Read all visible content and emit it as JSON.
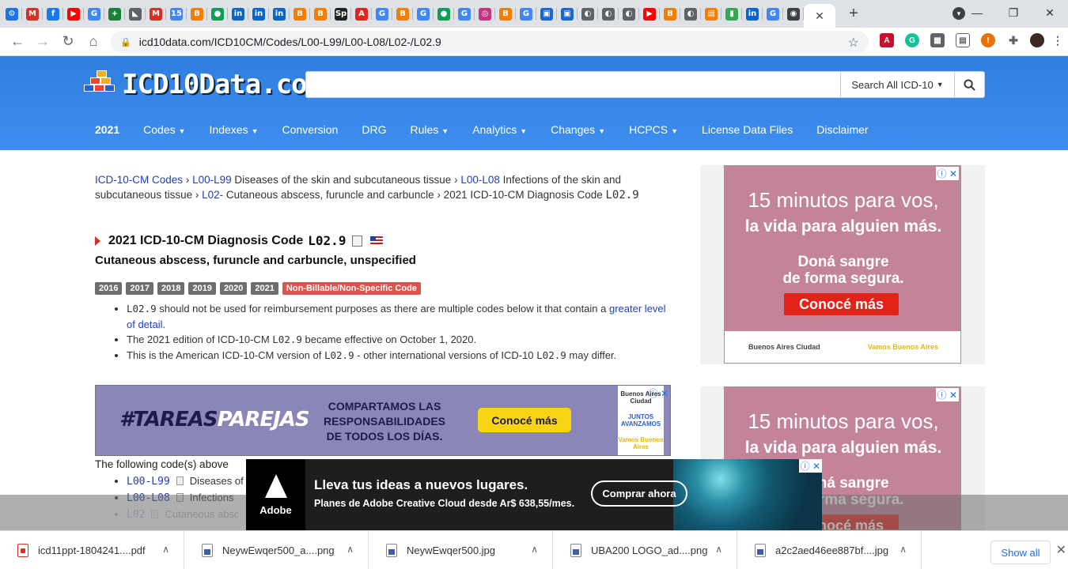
{
  "browser": {
    "tabs": [
      {
        "icon": "gear-icon",
        "glyph": "⚙",
        "color": "#1a73e8"
      },
      {
        "icon": "gmail-icon",
        "glyph": "M",
        "color": "#d93025"
      },
      {
        "icon": "facebook-icon",
        "glyph": "f",
        "color": "#1877f2"
      },
      {
        "icon": "youtube-icon",
        "glyph": "▶",
        "color": "#ff0000"
      },
      {
        "icon": "google-icon",
        "glyph": "G",
        "color": "#4285f4"
      },
      {
        "icon": "sheets-plus-icon",
        "glyph": "+",
        "color": "#188038"
      },
      {
        "icon": "bird-icon",
        "glyph": "◣",
        "color": "#5f6368"
      },
      {
        "icon": "gmail-icon",
        "glyph": "M",
        "color": "#d93025"
      },
      {
        "icon": "calendar-icon",
        "glyph": "15",
        "color": "#4285f4"
      },
      {
        "icon": "blogger-icon",
        "glyph": "B",
        "color": "#f57d00"
      },
      {
        "icon": "green-circle-icon",
        "glyph": "●",
        "color": "#0f9d58"
      },
      {
        "icon": "linkedin-icon",
        "glyph": "in",
        "color": "#0a66c2"
      },
      {
        "icon": "linkedin-icon",
        "glyph": "in",
        "color": "#0a66c2"
      },
      {
        "icon": "linkedin-icon",
        "glyph": "in",
        "color": "#0a66c2"
      },
      {
        "icon": "blogger-icon",
        "glyph": "B",
        "color": "#f57d00"
      },
      {
        "icon": "blogger-icon",
        "glyph": "B",
        "color": "#f57d00"
      },
      {
        "icon": "sp-icon",
        "glyph": "Sp",
        "color": "#222222"
      },
      {
        "icon": "adobe-icon",
        "glyph": "A",
        "color": "#e1251b"
      },
      {
        "icon": "google-icon",
        "glyph": "G",
        "color": "#4285f4"
      },
      {
        "icon": "blogger-icon",
        "glyph": "B",
        "color": "#f57d00"
      },
      {
        "icon": "translate-icon",
        "glyph": "G",
        "color": "#4285f4"
      },
      {
        "icon": "green-circle-icon",
        "glyph": "●",
        "color": "#0f9d58"
      },
      {
        "icon": "google-icon",
        "glyph": "G",
        "color": "#4285f4"
      },
      {
        "icon": "instagram-icon",
        "glyph": "◎",
        "color": "#c13584"
      },
      {
        "icon": "blogger-icon",
        "glyph": "B",
        "color": "#f57d00"
      },
      {
        "icon": "translate-icon",
        "glyph": "G",
        "color": "#4285f4"
      },
      {
        "icon": "blue-square-icon",
        "glyph": "▣",
        "color": "#1967d2"
      },
      {
        "icon": "blue-square-icon",
        "glyph": "▣",
        "color": "#1967d2"
      },
      {
        "icon": "globe-icon",
        "glyph": "◐",
        "color": "#5f6368"
      },
      {
        "icon": "globe-icon",
        "glyph": "◐",
        "color": "#5f6368"
      },
      {
        "icon": "globe-icon",
        "glyph": "◐",
        "color": "#5f6368"
      },
      {
        "icon": "youtube-icon",
        "glyph": "▶",
        "color": "#ff0000"
      },
      {
        "icon": "blogger-icon",
        "glyph": "B",
        "color": "#f57d00"
      },
      {
        "icon": "globe-icon",
        "glyph": "◐",
        "color": "#5f6368"
      },
      {
        "icon": "orange-square-icon",
        "glyph": "▤",
        "color": "#f57d00"
      },
      {
        "icon": "bookmark-icon",
        "glyph": "▮",
        "color": "#34a853"
      },
      {
        "icon": "linkedin-icon",
        "glyph": "in",
        "color": "#0a66c2"
      },
      {
        "icon": "google-icon",
        "glyph": "G",
        "color": "#4285f4"
      },
      {
        "icon": "chrome-icon",
        "glyph": "◉",
        "color": "#3c4043"
      }
    ],
    "active_tab_close": "✕",
    "new_tab": "+",
    "window_controls": {
      "minimize": "—",
      "restore": "❐",
      "close": "✕"
    },
    "url": "icd10data.com/ICD10CM/Codes/L00-L99/L00-L08/L02-/L02.9"
  },
  "site": {
    "logo_text": "ICD10Data.com",
    "search_placeholder": "",
    "search_scope": "Search All ICD-10",
    "nav": [
      {
        "label": "2021",
        "dropdown": false
      },
      {
        "label": "Codes",
        "dropdown": true
      },
      {
        "label": "Indexes",
        "dropdown": true
      },
      {
        "label": "Conversion",
        "dropdown": false
      },
      {
        "label": "DRG",
        "dropdown": false
      },
      {
        "label": "Rules",
        "dropdown": true
      },
      {
        "label": "Analytics",
        "dropdown": true
      },
      {
        "label": "Changes",
        "dropdown": true
      },
      {
        "label": "HCPCS",
        "dropdown": true
      },
      {
        "label": "License Data Files",
        "dropdown": false
      },
      {
        "label": "Disclaimer",
        "dropdown": false
      }
    ]
  },
  "content": {
    "breadcrumb": {
      "c1_link": "ICD-10-CM Codes",
      "c2_link": "L00-L99",
      "c2_text": "Diseases of the skin and subcutaneous tissue",
      "c3_link": "L00-L08",
      "c3_text": "Infections of the skin and subcutaneous tissue",
      "c4_link": "L02-",
      "c4_text": "Cutaneous abscess, furuncle and carbuncle",
      "c5_text": "2021 ICD-10-CM Diagnosis Code",
      "c5_code": "L02.9",
      "sep": "›"
    },
    "title_prefix": "2021 ICD-10-CM Diagnosis Code",
    "title_code": "L02.9",
    "subtitle": "Cutaneous abscess, furuncle and carbuncle, unspecified",
    "years": [
      "2016",
      "2017",
      "2018",
      "2019",
      "2020",
      "2021"
    ],
    "billable_badge": "Non-Billable/Non-Specific Code",
    "bullets": {
      "b1_code": "L02.9",
      "b1_text": "should not be used for reimbursement purposes as there are multiple codes below it that contain a",
      "b1_link": "greater level of detail",
      "b1_end": ".",
      "b2_a": "The 2021 edition of ICD-10-CM",
      "b2_code": "L02.9",
      "b2_b": "became effective on October 1, 2020.",
      "b3_a": "This is the American ICD-10-CM version of",
      "b3_code": "L02.9",
      "b3_b": "- other international versions of ICD-10",
      "b3_code2": "L02.9",
      "b3_c": "may differ."
    },
    "following_text": "The following code(s) above",
    "sub_items": [
      {
        "code": "L00-L99",
        "text": "Diseases of"
      },
      {
        "code": "L00-L08",
        "text": "Infections"
      },
      {
        "code": "L02",
        "text": "Cutaneous absc"
      }
    ]
  },
  "ads": {
    "banner": {
      "tag_a": "#TAREAS",
      "tag_b": "PAREJAS",
      "mid_text": "COMPARTAMOS LAS RESPONSABILIDADES DE TODOS LOS DÍAS.",
      "button": "Conocé más",
      "logo_1": "Buenos Aires Ciudad",
      "logo_2": "JUNTOS AVANZAMOS",
      "logo_3": "Vamos Buenos Aires"
    },
    "side": {
      "head_1": "15 minutos para vos,",
      "head_2": "la vida para alguien más.",
      "sub_1": "Doná sangre",
      "sub_2": "de forma segura.",
      "button": "Conocé más",
      "logo_1": "Buenos Aires Ciudad",
      "logo_2": "Vamos Buenos Aires"
    },
    "adobe": {
      "brand": "Adobe",
      "title": "Lleva tus ideas a nuevos lugares.",
      "sub": "Planes de Adobe Creative Cloud desde Ar$ 638,55/mes.",
      "button": "Comprar ahora"
    },
    "close": "ⓘ ✕"
  },
  "downloads": {
    "items": [
      {
        "name": "icd11ppt-1804241....pdf",
        "type": "pdf"
      },
      {
        "name": "NeywEwqer500_a....png",
        "type": "img"
      },
      {
        "name": "NeywEwqer500.jpg",
        "type": "img"
      },
      {
        "name": "UBA200 LOGO_ad....png",
        "type": "img"
      },
      {
        "name": "a2c2aed46ee887bf....jpg",
        "type": "img"
      }
    ],
    "show_all": "Show all",
    "close": "✕",
    "chevron": "∧"
  }
}
